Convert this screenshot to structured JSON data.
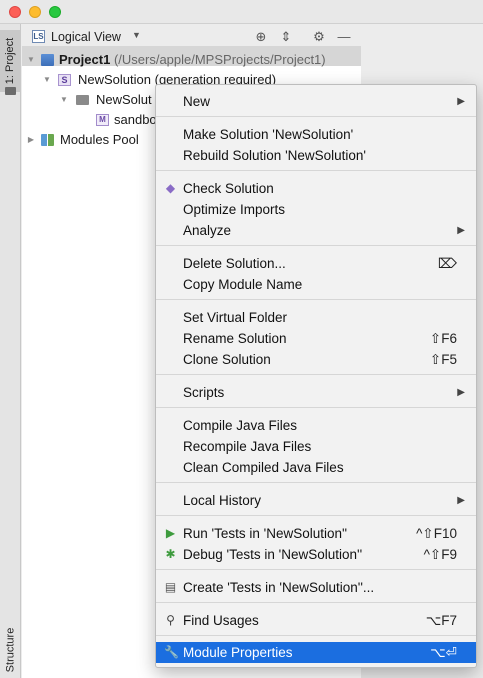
{
  "tool_strip": {
    "project_tab": "1: Project",
    "structure_tab": "Structure"
  },
  "panel": {
    "view_selector": "Logical View",
    "tree": [
      {
        "label": "Project1",
        "extra": "(/Users/apple/MPSProjects/Project1)"
      },
      {
        "label": "NewSolution",
        "extra": "(generation required)"
      },
      {
        "label": "NewSolut"
      },
      {
        "label": "sandbo"
      },
      {
        "label": "Modules Pool"
      }
    ]
  },
  "menu": {
    "items": [
      {
        "label": "New",
        "submenu": true
      },
      {
        "label": "Make Solution 'NewSolution'"
      },
      {
        "label": "Rebuild Solution 'NewSolution'"
      },
      {
        "label": "Check Solution",
        "icon": "check-solution-icon"
      },
      {
        "label": "Optimize Imports"
      },
      {
        "label": "Analyze",
        "submenu": true
      },
      {
        "label": "Delete Solution...",
        "icon": "delete-key-icon"
      },
      {
        "label": "Copy Module Name"
      },
      {
        "label": "Set Virtual Folder"
      },
      {
        "label": "Rename Solution",
        "shortcut": "⇧F6"
      },
      {
        "label": "Clone Solution",
        "shortcut": "⇧F5"
      },
      {
        "label": "Scripts",
        "submenu": true
      },
      {
        "label": "Compile Java Files"
      },
      {
        "label": "Recompile Java Files"
      },
      {
        "label": "Clean Compiled Java Files"
      },
      {
        "label": "Local History",
        "submenu": true
      },
      {
        "label": "Run 'Tests in 'NewSolution''",
        "shortcut": "^⇧F10",
        "icon": "run-icon"
      },
      {
        "label": "Debug 'Tests in 'NewSolution''",
        "shortcut": "^⇧F9",
        "icon": "debug-icon"
      },
      {
        "label": "Create 'Tests in 'NewSolution''...",
        "icon": "run-config-icon"
      },
      {
        "label": "Find Usages",
        "shortcut": "⌥F7",
        "icon": "search-icon"
      },
      {
        "label": "Module Properties",
        "shortcut": "⌥⏎",
        "icon": "wrench-icon",
        "highlighted": true
      }
    ]
  },
  "colors": {
    "highlight": "#1b6ee0",
    "run_green": "#3e9b3e",
    "check_purple": "#8a6cc6"
  }
}
